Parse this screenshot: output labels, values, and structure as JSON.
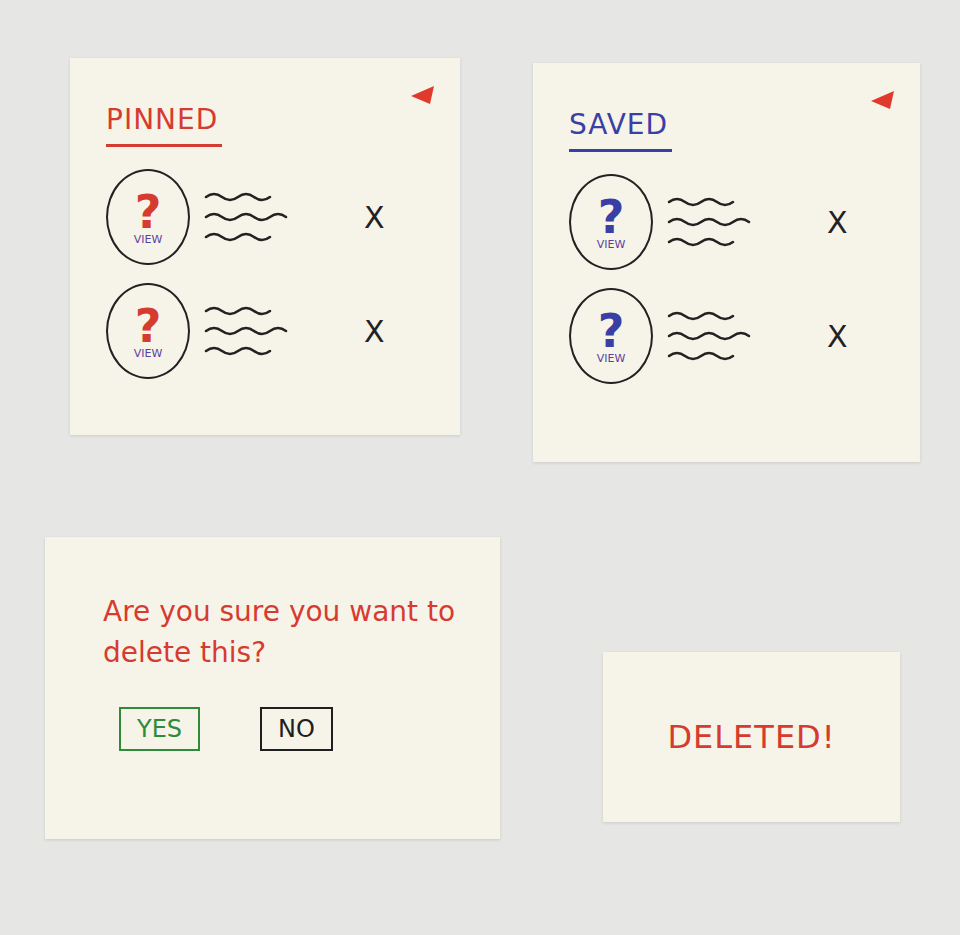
{
  "lists": [
    {
      "title": "PINNED",
      "color": "#d63b2f",
      "items": [
        {
          "icon": "?",
          "label": "VIEW",
          "remove": "X"
        },
        {
          "icon": "?",
          "label": "VIEW",
          "remove": "X"
        }
      ]
    },
    {
      "title": "SAVED",
      "color": "#3a3fa6",
      "items": [
        {
          "icon": "?",
          "label": "VIEW",
          "remove": "X"
        },
        {
          "icon": "?",
          "label": "VIEW",
          "remove": "X"
        }
      ]
    }
  ],
  "dialog": {
    "message": "Are you sure you want to delete this?",
    "buttons": [
      {
        "label": "YES",
        "color": "#2e8b3a"
      },
      {
        "label": "NO",
        "color": "#1f1f1f"
      }
    ]
  },
  "toast": {
    "text": "DELETED!"
  }
}
